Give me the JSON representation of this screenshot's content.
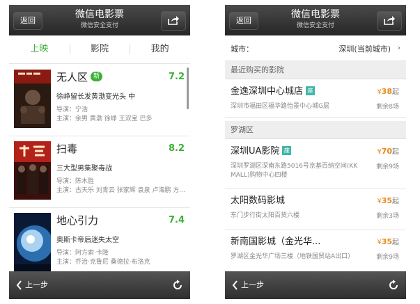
{
  "header": {
    "back_label": "返回",
    "title": "微信电影票",
    "subtitle": "微信安全支付"
  },
  "screen1": {
    "tabs": [
      {
        "label": "上映",
        "active": true
      },
      {
        "label": "影院",
        "active": false
      },
      {
        "label": "我的",
        "active": false
      }
    ],
    "movies": [
      {
        "title": "无人区",
        "badge": "新",
        "score": "7.2",
        "desc": "徐峥留长发黄渤变光头 中",
        "director": "导演：宁浩",
        "cast": "主演：余男 黄渤 徐峥 王双宝 巴多"
      },
      {
        "title": "扫毒",
        "badge": "",
        "score": "8.2",
        "desc": "三大型男集聚毒战",
        "director": "导演：陈木胜",
        "cast": "主演：古天乐 刘青云 张家辉 袁泉 卢海鹏 方..."
      },
      {
        "title": "地心引力",
        "badge": "",
        "score": "7.4",
        "desc": "奥斯卡帝后迷失太空",
        "director": "导演：阿方索·卡隆",
        "cast": "主演：乔治·克鲁尼 桑德拉·布洛克"
      }
    ]
  },
  "screen2": {
    "city_label": "城市：",
    "city_value": "深圳(当前城市)",
    "sections": [
      {
        "title": "最近购买的影院",
        "cinemas": [
          {
            "name": "金逸深圳中心城店",
            "badge": "座",
            "price_symbol": "¥",
            "price": "38",
            "price_suffix": "起",
            "address": "深圳市福田区福华路怡景中心城G层",
            "remaining": "剩余8场"
          }
        ]
      },
      {
        "title": "罗湖区",
        "cinemas": [
          {
            "name": "深圳UA影院",
            "badge": "座",
            "price_symbol": "¥",
            "price": "70",
            "price_suffix": "起",
            "address": "深圳罗湖区深南东路5016号京基百纳空间(KK MALL)购物中心四楼",
            "remaining": "剩余9场"
          },
          {
            "name": "太阳数码影城",
            "badge": "",
            "price_symbol": "¥",
            "price": "35",
            "price_suffix": "起",
            "address": "东门步行街太阳百货六楼",
            "remaining": "剩余3场"
          },
          {
            "name": "新南国影城（金光华...",
            "badge": "",
            "price_symbol": "¥",
            "price": "35",
            "price_suffix": "起",
            "address": "罗湖区金光华广场三楼（地铁国贸站A出口）",
            "remaining": "剩余9场"
          }
        ]
      }
    ]
  },
  "footer": {
    "back_label": "上一步"
  },
  "colors": {
    "accent_green": "#3cb035",
    "price_orange": "#e78a1d",
    "badge_teal": "#41b7a8",
    "nav_dark": "#2f2f2f"
  },
  "icons": [
    "share-icon",
    "chevron-left-icon",
    "refresh-icon",
    "chevron-right-icon"
  ]
}
